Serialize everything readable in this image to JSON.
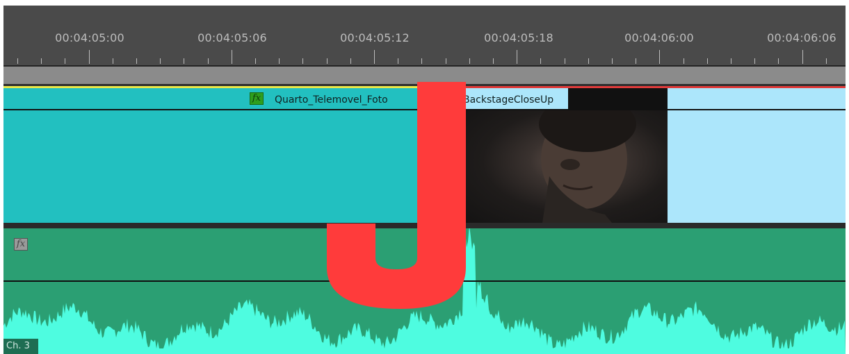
{
  "ruler": {
    "timecodes": [
      "00:04:05:00",
      "00:04:05:06",
      "00:04:05:12",
      "00:04:05:18",
      "00:04:06:00",
      "00:04:06:06"
    ]
  },
  "video_track": {
    "clips": [
      {
        "name": "Quarto_Telemovel_Foto",
        "has_fx": true,
        "color": "#22c0c0"
      },
      {
        "name": "BackstageCloseUp",
        "has_fx": false,
        "color": "#ace6fb"
      }
    ]
  },
  "audio_track": {
    "channel_label": "Ch. 3",
    "has_fx": true,
    "color": "#2b9f73",
    "waveform_color": "#4efce0"
  },
  "overlay": {
    "letter": "J",
    "color": "#ff3b3b"
  },
  "colors": {
    "ruler_bg": "#4a4a4a",
    "in_point_marker": "#e8e84a",
    "out_marker": "#e03b3b"
  }
}
